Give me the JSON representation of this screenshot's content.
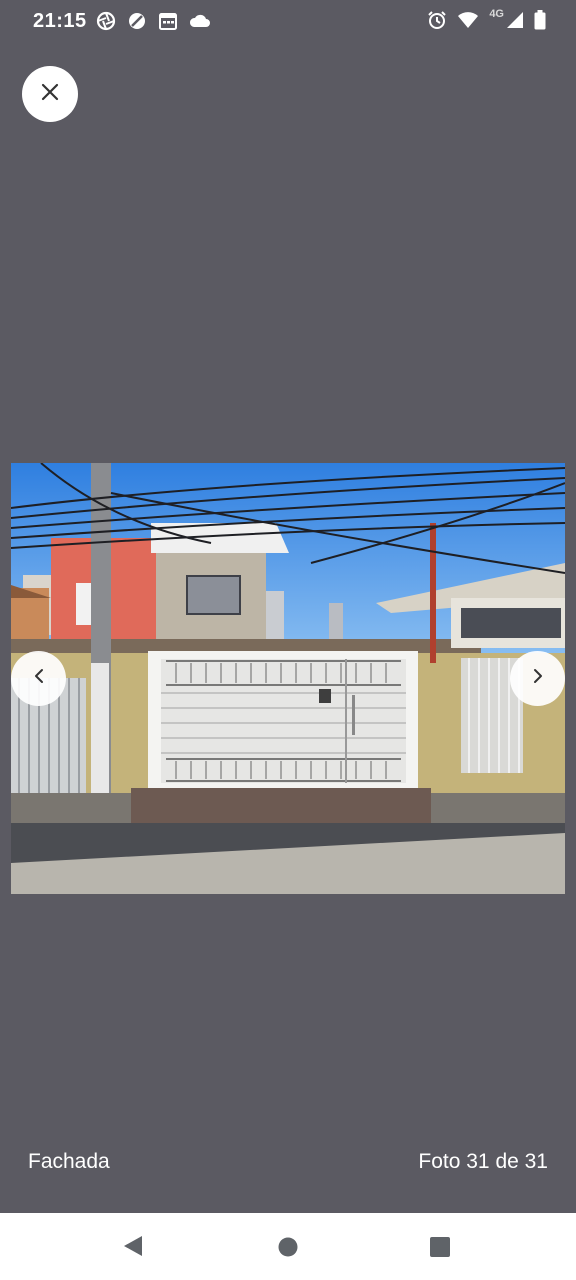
{
  "status_bar": {
    "time": "21:15",
    "left_icons": [
      "aperture-icon",
      "blocked-icon",
      "calendar-icon",
      "cloud-icon"
    ],
    "network_label": "4G",
    "right_icons": [
      "alarm-icon",
      "wifi-icon",
      "cellular-signal-icon",
      "battery-icon"
    ]
  },
  "viewer": {
    "close_icon": "close-icon",
    "prev_icon": "chevron-left-icon",
    "next_icon": "chevron-right-icon",
    "photo_subject": "house-facade-photo"
  },
  "footer": {
    "caption": "Fachada",
    "counter": "Foto 31 de 31"
  },
  "nav_bar": {
    "icons": [
      "back-icon",
      "home-icon",
      "recents-icon"
    ]
  },
  "colors": {
    "background": "#5b5a62",
    "text": "#ffffff",
    "nav_bar": "#ffffff",
    "nav_icons": "#5f6368"
  }
}
